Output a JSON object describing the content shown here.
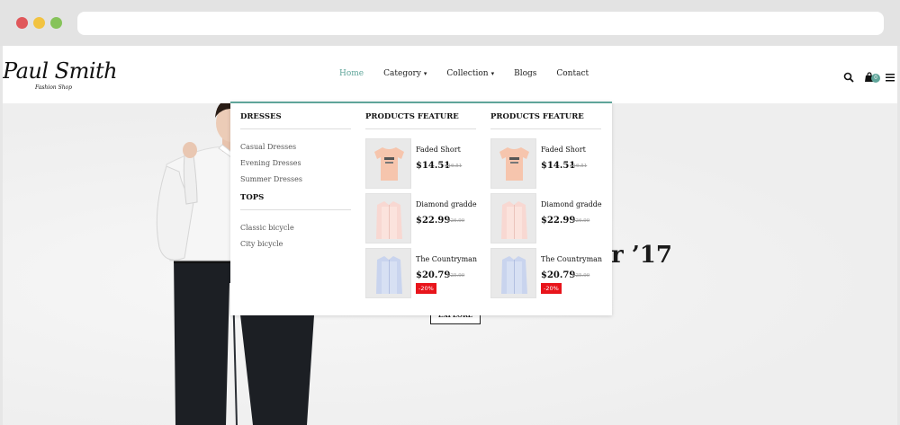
{
  "logo": {
    "main": "Paul Smith",
    "sub": "Fashion Shop"
  },
  "nav": [
    {
      "label": "Home",
      "active": true
    },
    {
      "label": "Category",
      "caret": "▾"
    },
    {
      "label": "Collection",
      "caret": "▾"
    },
    {
      "label": "Blogs"
    },
    {
      "label": "Contact"
    }
  ],
  "header_icons": {
    "search": "search-icon",
    "cart": "shopping-bag-icon",
    "cart_count": "0",
    "menu": "hamburger-menu-icon"
  },
  "hero": {
    "title_partial": "r ’17",
    "button": "EXPLORE"
  },
  "mega_menu": {
    "column1": {
      "heading": "DRESSES",
      "links": [
        "Casual Dresses",
        "Evening Dresses",
        "Summer Dresses"
      ],
      "heading2": "TOPS",
      "links2": [
        "Classic bicycle",
        "City bicycle"
      ]
    },
    "column2": {
      "heading": "PRODUCTS FEATURE",
      "products": [
        {
          "name": "Faded Short",
          "price": "$14.51",
          "old_price": "$16.51",
          "badge": ""
        },
        {
          "name": "Diamond gradde",
          "price": "$22.99",
          "old_price": "$26.99",
          "badge": ""
        },
        {
          "name": "The Countryman",
          "price": "$20.79",
          "old_price": "$25.99",
          "badge": "-20%"
        }
      ]
    },
    "column3": {
      "heading": "PRODUCTS FEATURE",
      "products": [
        {
          "name": "Faded Short",
          "price": "$14.51",
          "old_price": "$16.51",
          "badge": ""
        },
        {
          "name": "Diamond gradde",
          "price": "$22.99",
          "old_price": "$26.99",
          "badge": ""
        },
        {
          "name": "The Countryman",
          "price": "$20.79",
          "old_price": "$25.99",
          "badge": "-20%"
        }
      ]
    }
  },
  "colors": {
    "accent": "#5fa59a",
    "sale": "#e8141b"
  }
}
